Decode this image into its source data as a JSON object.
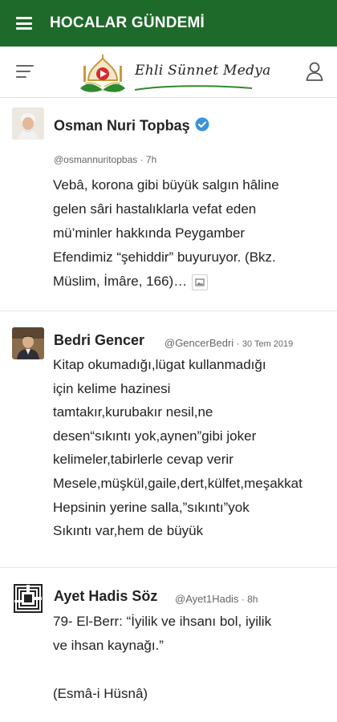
{
  "app": {
    "title": "HOCALAR GÜNDEMİ",
    "accent_color": "#1e6a2a",
    "logo_text": "Ehli Sünnet Medya"
  },
  "icons": {
    "menu": "hamburger-menu-icon",
    "filter": "filter-lines-icon",
    "profile": "user-profile-icon",
    "verified": "verified-badge-icon",
    "media": "image-attachment-icon"
  },
  "posts": [
    {
      "name": "Osman Nuri Topbaş",
      "handle": "@osmannuritopbas",
      "time": "7h",
      "verified": true,
      "text": "Vebâ, korona gibi büyük salgın hâline\ngelen sâri hastalıklarla vefat eden\nmü’minler hakkında Peygamber\nEfendimiz “şehiddir” buyuruyor. (Bkz.\nMüslim, İmâre, 166)…"
    },
    {
      "name": "Bedri Gencer",
      "handle": "@GencerBedri",
      "time": "30 Tem 2019",
      "verified": false,
      "text": "Kitap okumadığı,lügat kullanmadığı\niçin kelime hazinesi\ntamtakır,kurubakır nesil,ne\ndesen“sıkıntı yok,aynen”gibi joker\nkelimeler,tabirlerle cevap verir\nMesele,müşkül,gaile,dert,külfet,meşakkat\nHepsinin yerine salla,”sıkıntı”yok\nSıkıntı var,hem de büyük"
    },
    {
      "name": "Ayet Hadis Söz",
      "handle": "@Ayet1Hadis",
      "time": "8h",
      "verified": false,
      "text": "79- El-Berr: “İyilik ve ihsanı bol, iyilik\nve ihsan kaynağı.”\n\n(Esmâ-i Hüsnâ)"
    }
  ]
}
